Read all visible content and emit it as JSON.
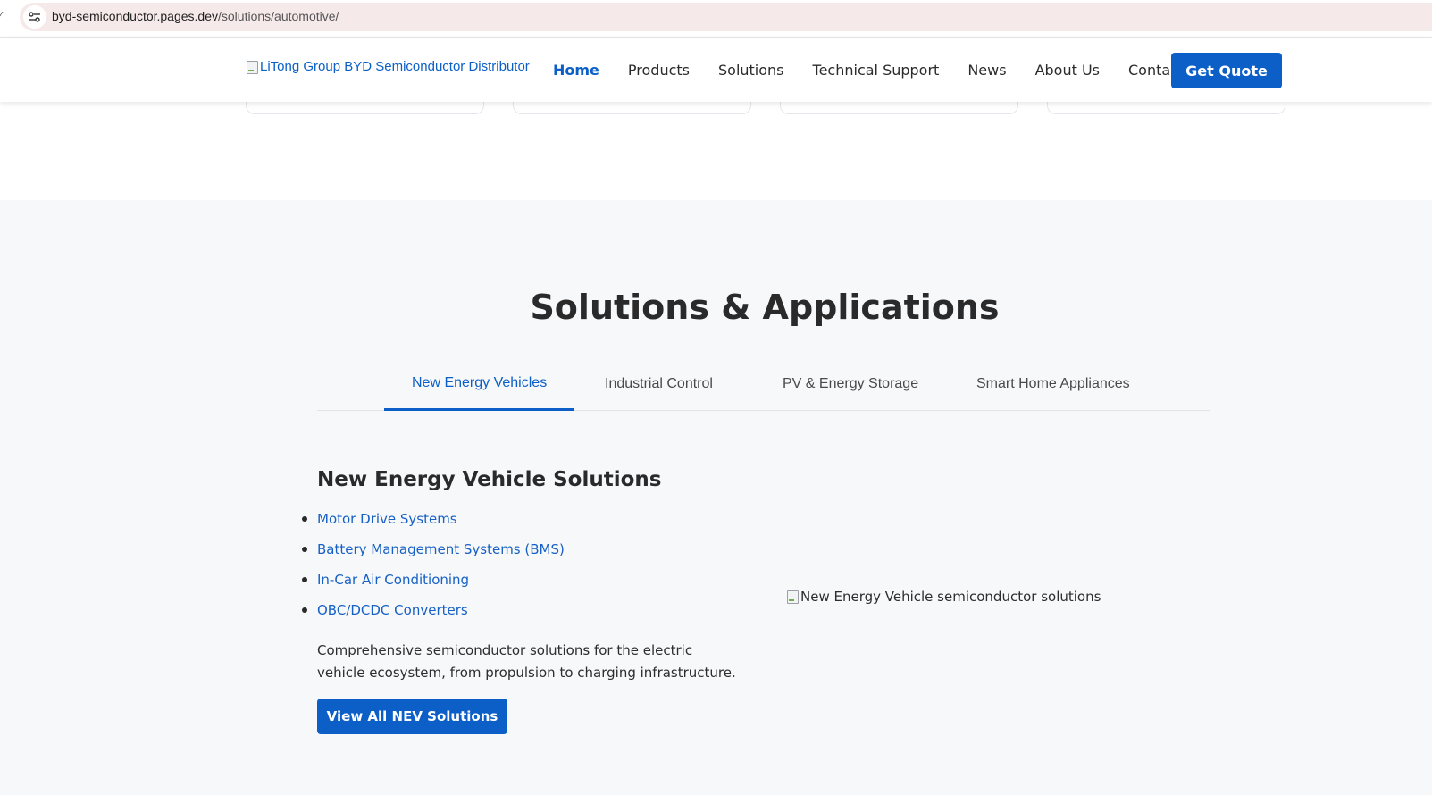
{
  "browser": {
    "url_host": "byd-semiconductor.pages.dev",
    "url_path": "/solutions/automotive/"
  },
  "header": {
    "logo_alt": "LiTong Group BYD Semiconductor Distributor",
    "nav": [
      "Home",
      "Products",
      "Solutions",
      "Technical Support",
      "News",
      "About Us",
      "Contact"
    ],
    "active_nav": "Home",
    "cta_label": "Get Quote"
  },
  "solutions": {
    "title": "Solutions & Applications",
    "tabs": [
      "New Energy Vehicles",
      "Industrial Control",
      "PV & Energy Storage",
      "Smart Home Appliances"
    ],
    "active_tab": "New Energy Vehicles",
    "panel": {
      "title": "New Energy Vehicle Solutions",
      "items": [
        "Motor Drive Systems",
        "Battery Management Systems (BMS)",
        "In-Car Air Conditioning",
        "OBC/DCDC Converters"
      ],
      "description": "Comprehensive semiconductor solutions for the electric vehicle ecosystem, from propulsion to charging infrastructure.",
      "button_label": "View All NEV Solutions",
      "image_alt": "New Energy Vehicle semiconductor solutions"
    }
  },
  "colors": {
    "brand_blue": "#0b5fc7",
    "section_bg": "#f7f8fa"
  }
}
